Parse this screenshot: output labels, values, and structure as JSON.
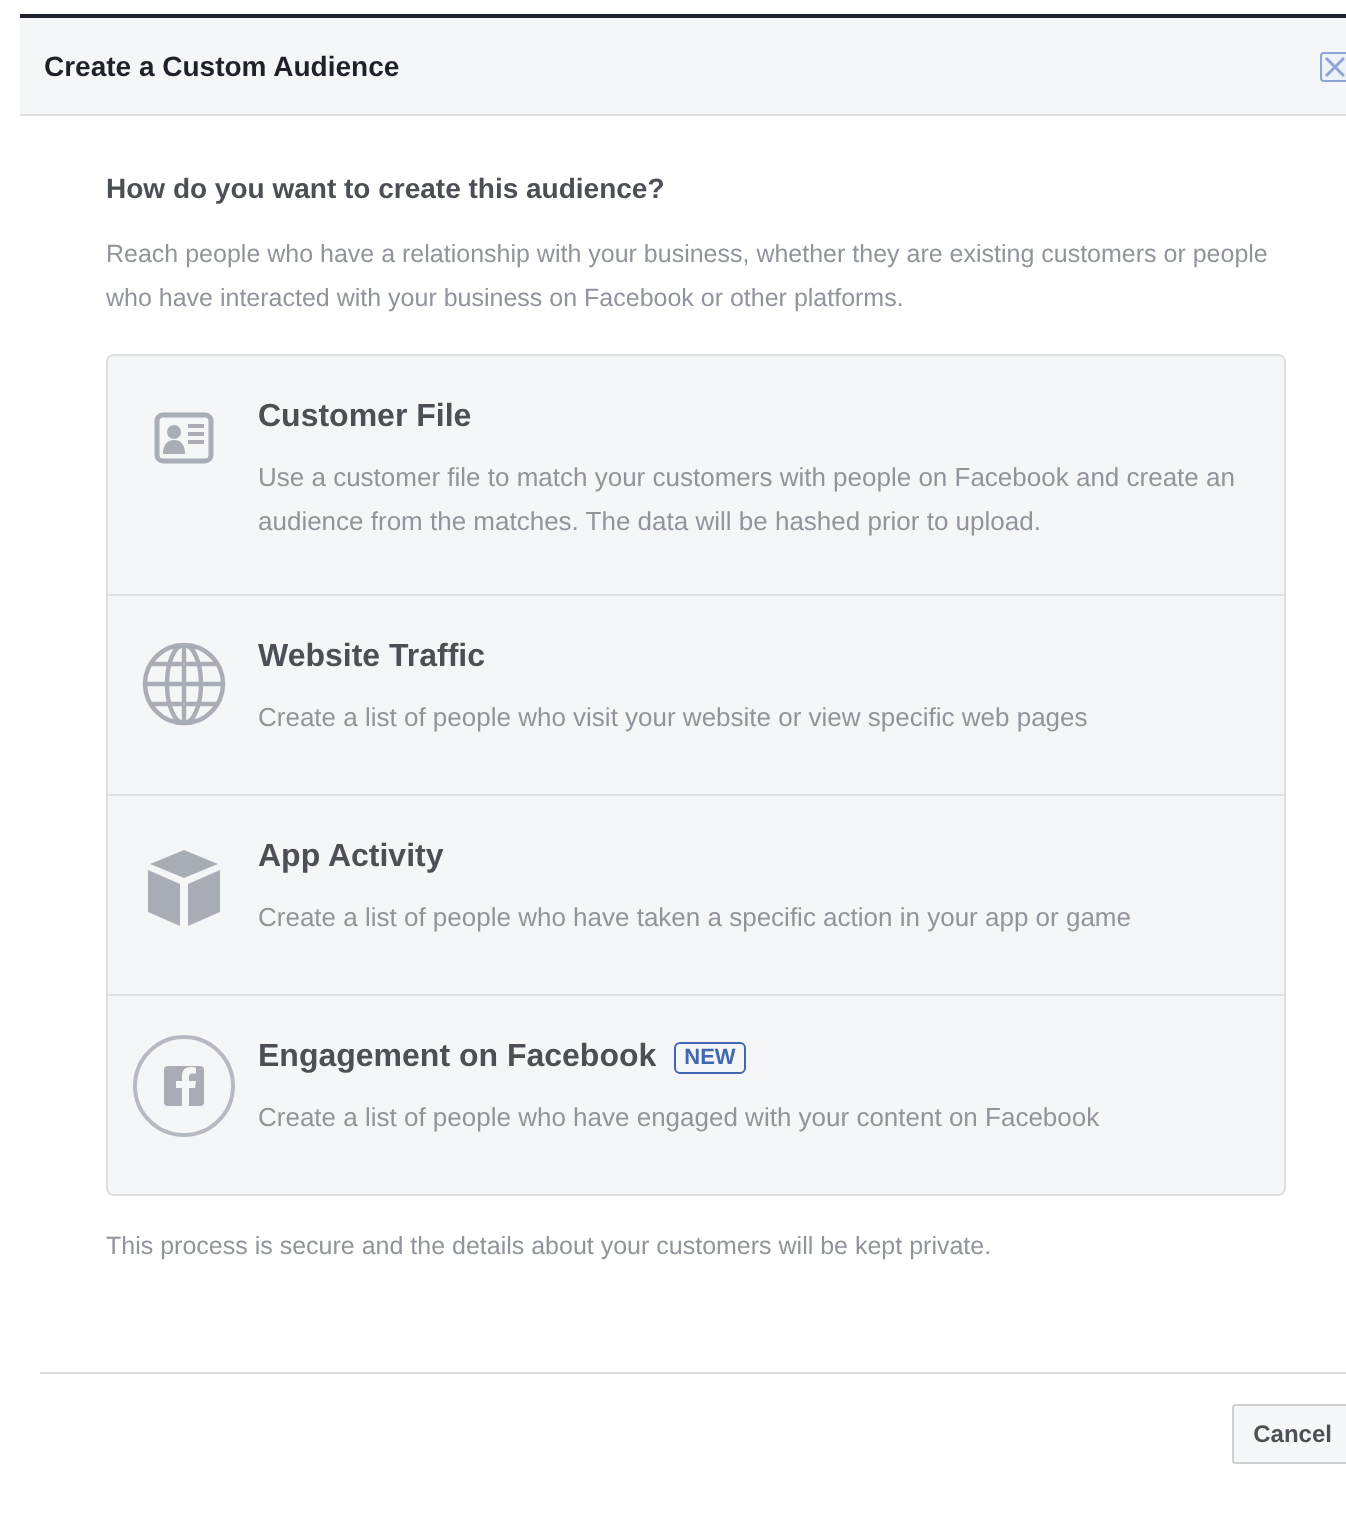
{
  "dialog": {
    "title": "Create a Custom Audience"
  },
  "question": "How do you want to create this audience?",
  "intro": "Reach people who have a relationship with your business, whether they are existing customers or people who have interacted with your business on Facebook or other platforms.",
  "options": [
    {
      "kind": "customer-file",
      "title": "Customer File",
      "description": "Use a customer file to match your customers with people on Facebook and create an audience from the matches. The data will be hashed prior to upload."
    },
    {
      "kind": "website",
      "title": "Website Traffic",
      "description": "Create a list of people who visit your website or view specific web pages"
    },
    {
      "kind": "app",
      "title": "App Activity",
      "description": "Create a list of people who have taken a specific action in your app or game"
    },
    {
      "kind": "engagement",
      "title": "Engagement on Facebook",
      "badge": "NEW",
      "description": "Create a list of people who have engaged with your content on Facebook"
    }
  ],
  "note": "This process is secure and the details about your customers will be kept private.",
  "buttons": [
    "Cancel"
  ]
}
